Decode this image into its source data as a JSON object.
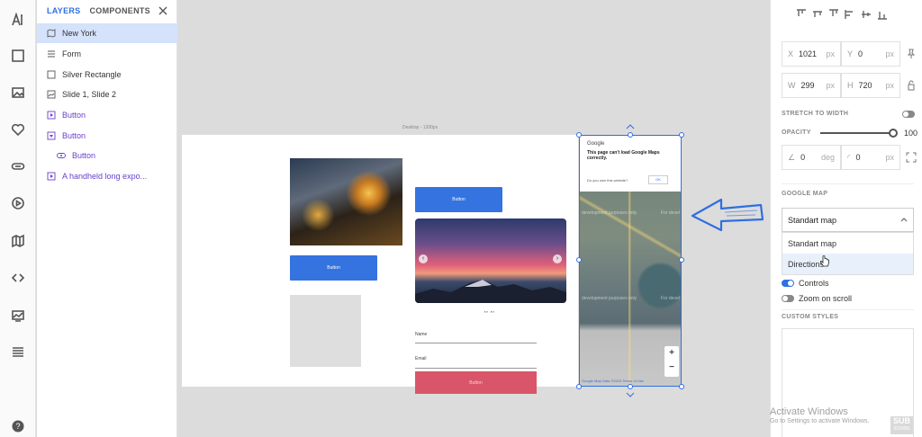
{
  "layers_panel": {
    "tab_layers": "LAYERS",
    "tab_components": "COMPONENTS",
    "items": [
      {
        "label": "New York"
      },
      {
        "label": "Form"
      },
      {
        "label": "Silver Rectangle"
      },
      {
        "label": "Slide 1, Slide 2"
      },
      {
        "label": "Button"
      },
      {
        "label": "Button"
      },
      {
        "label": "Button"
      },
      {
        "label": "A handheld long expo..."
      }
    ]
  },
  "canvas": {
    "artboard_label": "Desktop - 1200px",
    "button1": "Button",
    "button2": "Button",
    "slider_dots": "▪▪ ▪▪",
    "name_label": "Name",
    "email_label": "Email",
    "submit_button": "Button",
    "map": {
      "google": "Google",
      "message": "This page can't load Google Maps correctly.",
      "own_site": "Do you own this website?",
      "ok": "OK",
      "watermark1": "development purposes only",
      "watermark2": "For devel",
      "watermark3": "development purposes only",
      "watermark4": "For devel",
      "zoom_in": "+",
      "zoom_out": "−",
      "footer": "Google  Map Data ©2023  Terms of Use"
    }
  },
  "properties": {
    "x_label": "X",
    "x_value": "1021",
    "x_unit": "px",
    "y_label": "Y",
    "y_value": "0",
    "y_unit": "px",
    "w_label": "W",
    "w_value": "299",
    "w_unit": "px",
    "h_label": "H",
    "h_value": "720",
    "h_unit": "px",
    "stretch_label": "STRETCH TO WIDTH",
    "opacity_label": "OPACITY",
    "opacity_value": "100",
    "rotation_value": "0",
    "rotation_unit": "deg",
    "radius_value": "0",
    "radius_unit": "px",
    "google_map_label": "GOOGLE MAP",
    "map_type_selected": "Standart map",
    "map_type_options": [
      "Standart map",
      "Directions"
    ],
    "controls_label": "Controls",
    "zoom_scroll_label": "Zoom on scroll",
    "custom_styles_label": "CUSTOM STYLES"
  },
  "overlay": {
    "activate_title": "Activate Windows",
    "activate_sub": "Go to Settings to activate Windows.",
    "sub_badge": "SUB",
    "sub_badge_small": "SCRIBE"
  },
  "colors": {
    "accent": "#2f6fe0",
    "button_blue": "#3473e0",
    "button_red": "#d9566a",
    "selected_layer": "#d4e2fb"
  }
}
